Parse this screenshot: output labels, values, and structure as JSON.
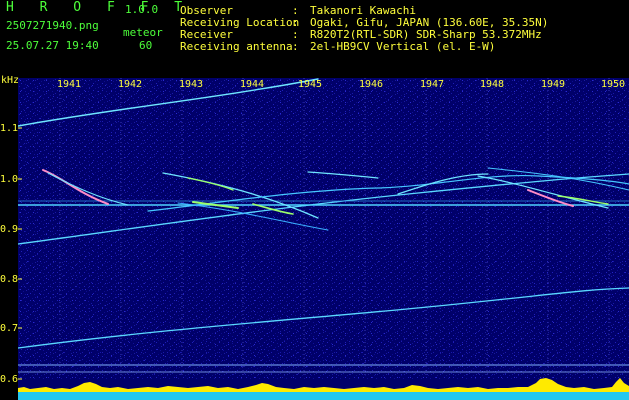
{
  "header": {
    "app_title": "H R O F F T",
    "version": "1.0.0",
    "filename": "2507271940.png",
    "mode_label": "meteor",
    "datetime": "25.07.27 19:40",
    "mode_value": "60"
  },
  "info": {
    "observer_label": "Observer",
    "observer_value": "Takanori Kawachi",
    "location_label": "Receiving Location",
    "location_value": "Ogaki, Gifu, JAPAN (136.60E, 35.35N)",
    "receiver_label": "Receiver",
    "receiver_value": "R820T2(RTL-SDR) SDR-Sharp 53.372MHz",
    "antenna_label": "Receiving antenna",
    "antenna_value": "2el-HB9CV Vertical (el. E-W)",
    "colon": ":"
  },
  "axes": {
    "freq_unit": "kHz",
    "y_ticks": [
      "1.1",
      "1.0",
      "0.9",
      "0.8",
      "0.7",
      "0.6"
    ],
    "x_ticks": [
      "1941",
      "1942",
      "1943",
      "1944",
      "1945",
      "1946",
      "1947",
      "1948",
      "1949",
      "1950"
    ]
  },
  "colors": {
    "background": "#00006a",
    "header_green": "#4dff3a",
    "header_yellow": "#ffff3c",
    "signal_cyan": "#6fe6ff",
    "meteor_pink": "#ff8cc8",
    "meteor_green": "#9cff6a",
    "level_yellow": "#ffea00",
    "level_cyan": "#23c8f0"
  }
}
